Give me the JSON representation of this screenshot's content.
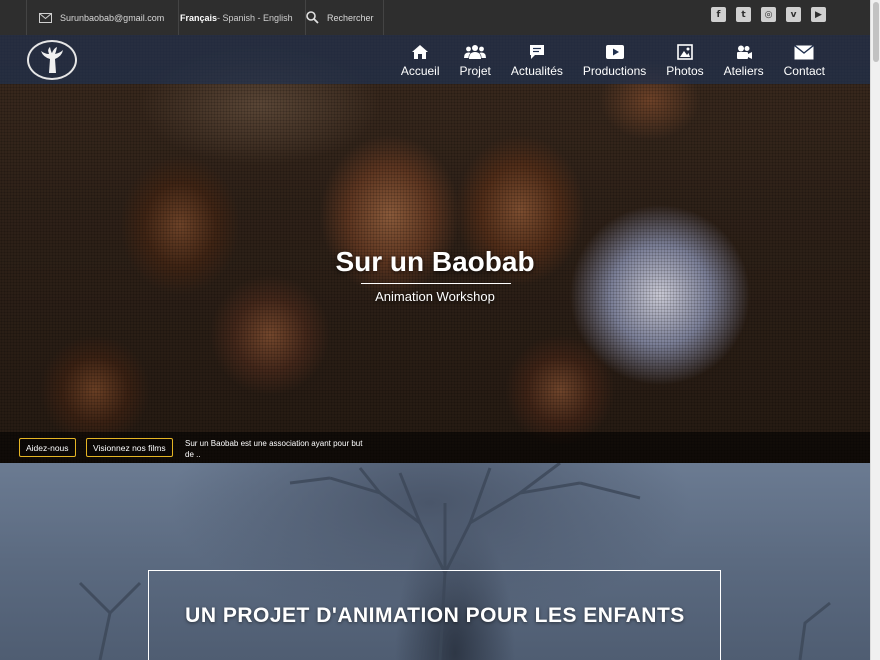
{
  "topbar": {
    "email": "Surunbaobab@gmail.com",
    "lang_current": "Français",
    "lang_others": " - Spanish - English",
    "search_placeholder": "Rechercher",
    "socials": [
      {
        "icon": "facebook-icon",
        "glyph": "f"
      },
      {
        "icon": "twitter-icon",
        "glyph": "t"
      },
      {
        "icon": "instagram-icon",
        "glyph": "◎"
      },
      {
        "icon": "vimeo-icon",
        "glyph": "v"
      },
      {
        "icon": "youtube-icon",
        "glyph": "▶"
      }
    ]
  },
  "nav": {
    "items": [
      {
        "label": "Accueil",
        "icon": "home-icon"
      },
      {
        "label": "Projet",
        "icon": "group-icon"
      },
      {
        "label": "Actualités",
        "icon": "chat-icon"
      },
      {
        "label": "Productions",
        "icon": "play-icon"
      },
      {
        "label": "Photos",
        "icon": "image-icon"
      },
      {
        "label": "Ateliers",
        "icon": "camera-icon"
      },
      {
        "label": "Contact",
        "icon": "envelope-icon"
      }
    ]
  },
  "hero": {
    "title": "Sur un Baobab",
    "subtitle": "Animation Workshop",
    "btn_help": "Aidez-nous",
    "btn_films": "Visionnez nos films",
    "description": "Sur un Baobab est une association ayant pour but de .."
  },
  "section2": {
    "title": "UN PROJET D'ANIMATION POUR LES ENFANTS"
  },
  "colors": {
    "topbar_bg": "#2e2e2e",
    "nav_bg": "#20304e",
    "accent_yellow": "#e5b524"
  }
}
